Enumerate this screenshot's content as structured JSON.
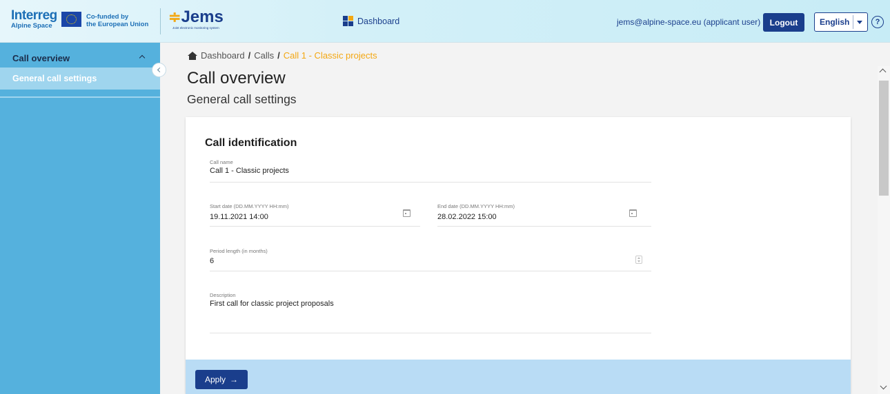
{
  "header": {
    "interreg_brand": "Interreg",
    "interreg_region": "Alpine Space",
    "cofunded_line1": "Co-funded by",
    "cofunded_line2": "the European Union",
    "jems_name": "Jems",
    "jems_tagline": "Joint electronic monitoring system",
    "dashboard_label": "Dashboard",
    "user_email": "jems@alpine-space.eu (applicant user)",
    "logout_label": "Logout",
    "language": "English",
    "help_glyph": "?",
    "icons": [
      "eu-flag-icon",
      "dashboard-icon",
      "chevron-down-icon",
      "help-icon"
    ],
    "colors": {
      "primary": "#1a3e8c",
      "accent": "#f3a712"
    }
  },
  "sidebar": {
    "section_label": "Call overview",
    "items": [
      {
        "label": "General call settings",
        "active": true
      }
    ],
    "colors": {
      "background": "#55b1dd",
      "active_item": "#9fd5ee"
    }
  },
  "breadcrumb": {
    "items": [
      "Dashboard",
      "Calls",
      "Call 1 - Classic projects"
    ],
    "separator": "/"
  },
  "page": {
    "title": "Call overview",
    "subtitle": "General call settings"
  },
  "form": {
    "section_title": "Call identification",
    "call_name": {
      "label": "Call name",
      "value": "Call 1 - Classic projects"
    },
    "start_date": {
      "label": "Start date (DD.MM.YYYY HH:mm)",
      "value": "19.11.2021 14:00"
    },
    "end_date": {
      "label": "End date (DD.MM.YYYY HH:mm)",
      "value": "28.02.2022 15:00"
    },
    "period_length": {
      "label": "Period length (in months)",
      "value": "6"
    },
    "description": {
      "label": "Description",
      "value": "First call for classic project proposals"
    },
    "apply_label": "Apply",
    "apply_arrow": "→"
  }
}
